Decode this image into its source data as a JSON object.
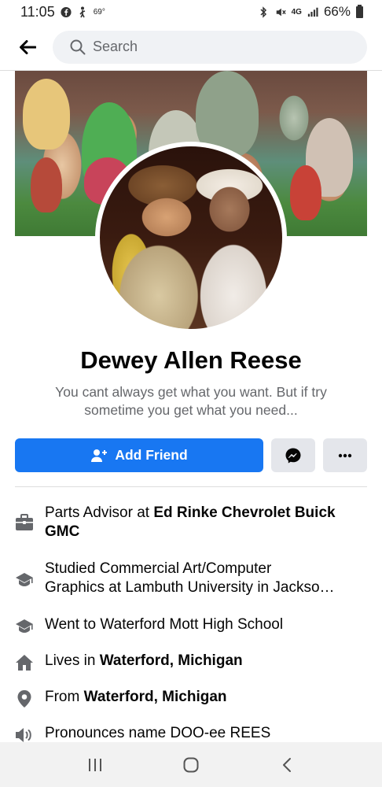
{
  "status_bar": {
    "time": "11:05",
    "temperature": "69°",
    "network": "4G",
    "battery": "66%"
  },
  "search": {
    "placeholder": "Search"
  },
  "profile": {
    "name": "Dewey Allen Reese",
    "bio_line1": "You cant always get what you want. But if try",
    "bio_line2": "sometime you get what you need..."
  },
  "actions": {
    "add_friend_label": "Add Friend",
    "primary_color": "#1877f2"
  },
  "intro": {
    "work_prefix": "Parts Advisor at ",
    "work_company": "Ed Rinke Chevrolet Buick GMC",
    "college_line1": "Studied Commercial Art/Computer",
    "college_line2": "Graphics at Lambuth University in Jackso…",
    "high_school": "Went to Waterford Mott High School",
    "lives_prefix": "Lives in ",
    "lives_place": "Waterford, Michigan",
    "from_prefix": "From ",
    "from_place": "Waterford, Michigan",
    "pronounce": "Pronounces name DOO-ee REES"
  },
  "icons": {
    "work": "briefcase-icon",
    "college": "graduation-cap-icon",
    "high_school": "graduation-cap-icon",
    "lives": "house-icon",
    "from": "location-pin-icon",
    "pronounce": "speaker-icon"
  }
}
